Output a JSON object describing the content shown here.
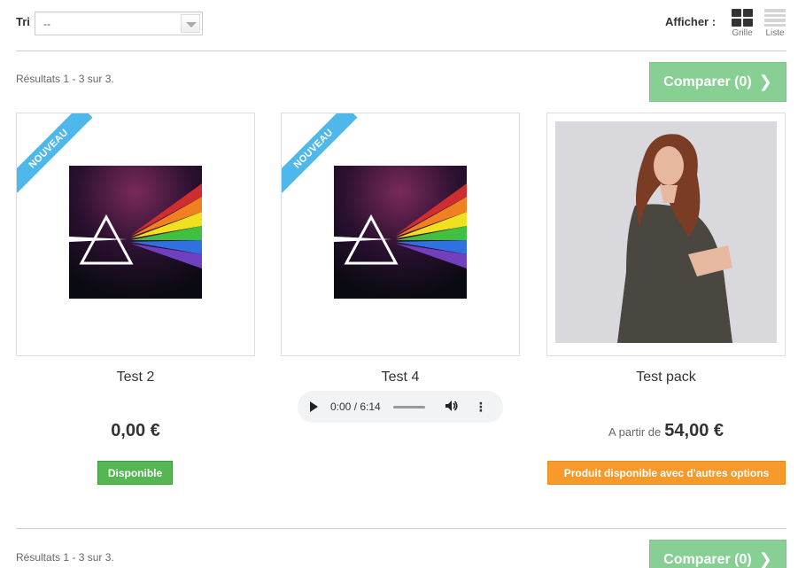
{
  "toolbar": {
    "sort_label": "Tri",
    "sort_value": "--",
    "view_label": "Afficher :",
    "grid_label": "Grille",
    "list_label": "Liste"
  },
  "results_top": "Résultats 1 - 3 sur 3.",
  "results_bottom": "Résultats 1 - 3 sur 3.",
  "compare_label": "Comparer (0)",
  "products": [
    {
      "name": "Test 2",
      "ribbon": "Nouveau",
      "price": "0,00 €",
      "availability": "Disponible"
    },
    {
      "name": "Test 4",
      "ribbon": "Nouveau",
      "audio_time": "0:00 / 6:14"
    },
    {
      "name": "Test pack",
      "price_prefix": "A partir de",
      "price": "54,00 €",
      "availability": "Produit disponible avec d'autres options"
    }
  ],
  "colors": {
    "compare_green": "#87cf93",
    "ribbon_blue": "#4fb8ea",
    "available_green": "#54b751",
    "options_orange": "#f89a2b"
  }
}
